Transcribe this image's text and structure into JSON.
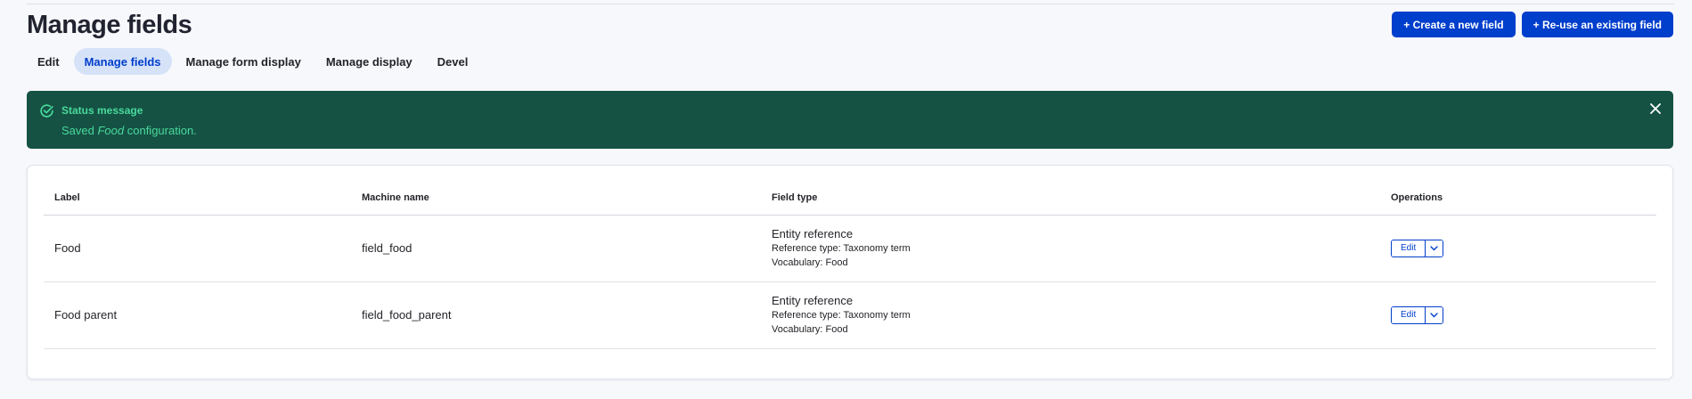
{
  "page": {
    "title": "Manage fields"
  },
  "actions": {
    "create": "+ Create a new field",
    "reuse": "+ Re-use an existing field"
  },
  "tabs": [
    {
      "label": "Edit",
      "active": false
    },
    {
      "label": "Manage fields",
      "active": true
    },
    {
      "label": "Manage form display",
      "active": false
    },
    {
      "label": "Manage display",
      "active": false
    },
    {
      "label": "Devel",
      "active": false
    }
  ],
  "status": {
    "title": "Status message",
    "text_before": "Saved ",
    "text_em": "Food",
    "text_after": " configuration."
  },
  "table": {
    "headers": [
      "Label",
      "Machine name",
      "Field type",
      "Operations"
    ],
    "rows": [
      {
        "label": "Food",
        "machine_name": "field_food",
        "field_type": "Entity reference",
        "reference_type": "Reference type: Taxonomy term",
        "vocabulary": "Vocabulary: Food",
        "op_edit": "Edit"
      },
      {
        "label": "Food parent",
        "machine_name": "field_food_parent",
        "field_type": "Entity reference",
        "reference_type": "Reference type: Taxonomy term",
        "vocabulary": "Vocabulary: Food",
        "op_edit": "Edit"
      }
    ]
  },
  "colors": {
    "primary": "#003ecc",
    "status_bg": "#155244",
    "status_text": "#49d99b",
    "tab_active_bg": "#d5e2f8"
  },
  "icons": {
    "status": "check-circle-icon",
    "close": "close-icon",
    "toggle": "chevron-down-icon"
  }
}
